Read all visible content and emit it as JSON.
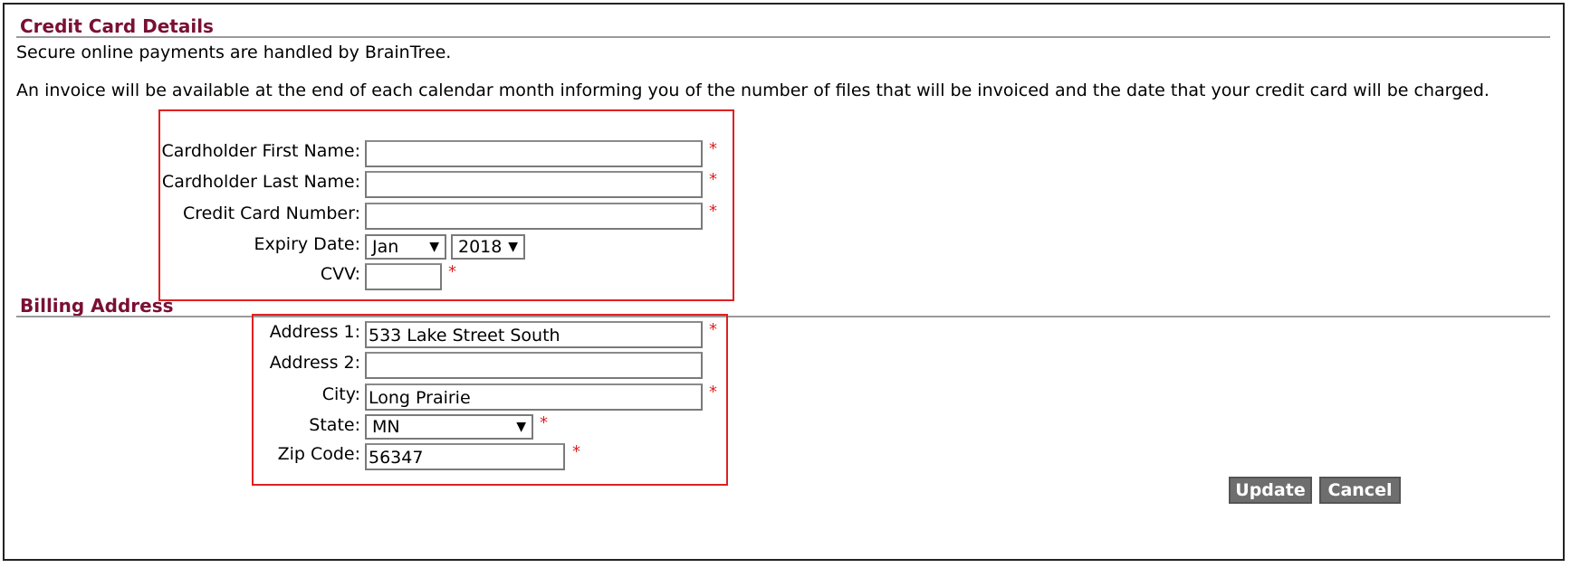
{
  "credit_card": {
    "title": "Credit Card Details",
    "intro": "Secure online payments are handled by BrainTree.",
    "invoice_note": "An invoice will be available at the end of each calendar month informing you of the number of files that will be invoiced and the date that your credit card will be charged.",
    "first_name_label": "Cardholder First Name:",
    "first_name_value": "",
    "last_name_label": "Cardholder Last Name:",
    "last_name_value": "",
    "card_number_label": "Credit Card Number:",
    "card_number_value": "",
    "expiry_label": "Expiry Date:",
    "expiry_month": "Jan",
    "expiry_year": "2018",
    "cvv_label": "CVV:",
    "cvv_value": ""
  },
  "billing": {
    "title": "Billing Address",
    "address1_label": "Address 1:",
    "address1_value": "533 Lake Street South",
    "address2_label": "Address 2:",
    "address2_value": "",
    "city_label": "City:",
    "city_value": "Long Prairie",
    "state_label": "State:",
    "state_value": "MN",
    "zip_label": "Zip Code:",
    "zip_value": "56347"
  },
  "required_marker": "*",
  "dropdown_arrow": "▼",
  "actions": {
    "update_label": "Update",
    "cancel_label": "Cancel"
  },
  "colors": {
    "section_title": "#7a1033",
    "highlight_border": "#e02020",
    "required": "#e02020",
    "button_bg": "#6e6e6e"
  }
}
